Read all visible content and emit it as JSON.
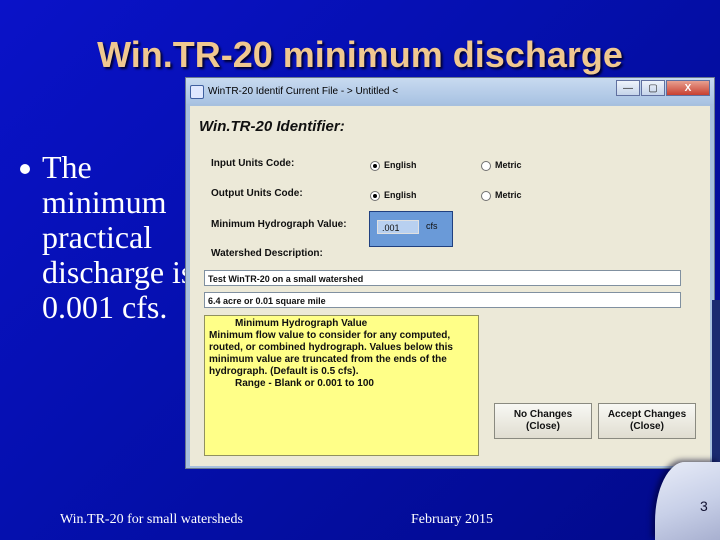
{
  "slide": {
    "title": "Win.TR-20 minimum discharge",
    "bullet_text": "The minimum practical discharge is 0.001 cfs.",
    "footer_left": "Win.TR-20 for small watersheds",
    "footer_date": "February 2015",
    "page_number": "3"
  },
  "window": {
    "title": "WinTR-20 Identif Current File - > Untitled <",
    "buttons": {
      "minimize": "—",
      "maximize": "▢",
      "close": "X"
    }
  },
  "form": {
    "heading": "Win.TR-20 Identifier:",
    "input_units_label": "Input Units Code:",
    "output_units_label": "Output Units Code:",
    "english_label": "English",
    "metric_label": "Metric",
    "input_units_selected": "English",
    "output_units_selected": "English",
    "min_hydrograph_label": "Minimum Hydrograph Value:",
    "min_hydrograph_value": ".001",
    "min_hydrograph_unit": "cfs",
    "watershed_desc_label": "Watershed Description:",
    "description_line1": "Test WinTR-20 on a small watershed",
    "description_line2": "6.4 acre or 0.01 square mile"
  },
  "help": {
    "title": "Minimum Hydrograph Value",
    "lines": [
      "Minimum flow value to consider for any computed,",
      "routed, or combined hydrograph. Values below this",
      "minimum value are truncated from the ends of the",
      "hydrograph.  (Default is 0.5 cfs).",
      "Range - Blank or 0.001 to 100"
    ]
  },
  "actions": {
    "no_changes": [
      "No Changes",
      "(Close)"
    ],
    "accept_changes": [
      "Accept Changes",
      "(Close)"
    ]
  }
}
